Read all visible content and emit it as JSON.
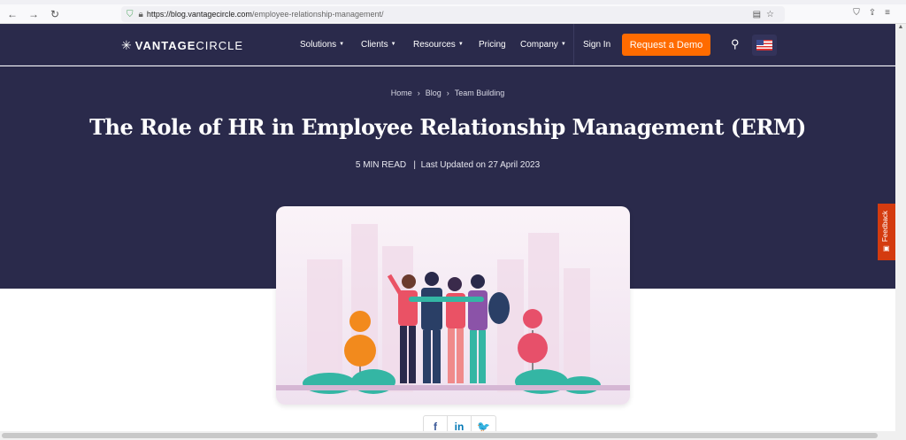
{
  "browser": {
    "url_host": "https://blog.vantagecircle.com",
    "url_path": "/employee-relationship-management/"
  },
  "nav": {
    "logo_bold": "VANTAGE",
    "logo_light": "CIRCLE",
    "items": [
      "Solutions",
      "Clients",
      "Resources",
      "Pricing",
      "Company"
    ],
    "sign_in": "Sign In",
    "cta": "Request a Demo"
  },
  "breadcrumb": [
    "Home",
    "Blog",
    "Team Building"
  ],
  "article": {
    "title": "The Role of HR in Employee Relationship Management (ERM)",
    "read_time": "5 MIN READ",
    "updated": "Last Updated on 27 April 2023"
  },
  "social": {
    "icons": [
      "facebook-icon",
      "linkedin-icon",
      "twitter-icon"
    ],
    "labels": [
      "f",
      "in",
      "🐦"
    ]
  },
  "feedback": {
    "label": "Feedback"
  },
  "colors": {
    "navy": "#2a2a4b",
    "accent": "#ff6b00",
    "feedback": "#d43b0f"
  }
}
